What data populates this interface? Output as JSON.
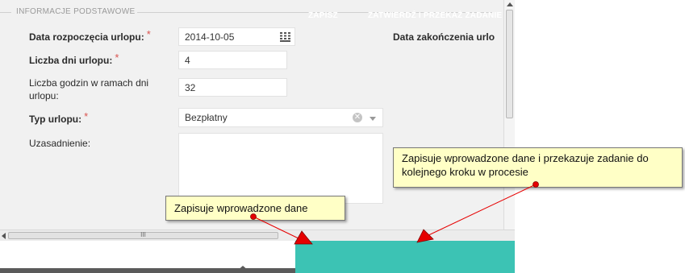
{
  "section": {
    "title": "INFORMACJE PODSTAWOWE"
  },
  "form": {
    "start_date_label": "Data rozpoczęcia urlopu:",
    "start_date_value": "2014-10-05",
    "end_date_label": "Data zakończenia urlo",
    "days_label": "Liczba dni urlopu:",
    "days_value": "4",
    "hours_label": "Liczba godzin w ramach dni urlopu:",
    "hours_value": "32",
    "type_label": "Typ urlopu:",
    "type_value": "Bezpłatny",
    "justification_label": "Uzasadnienie:",
    "justification_value": "",
    "required_mark": "*"
  },
  "buttons": {
    "save": "ZAPISZ",
    "approve": "ZATWIERDŹ I PRZEKAŻ ZADANIE"
  },
  "callouts": {
    "approve_note": "Zapisuje wprowadzone dane i przekazuje zadanie do kolejnego kroku w procesie",
    "save_note": "Zapisuje wprowadzone dane"
  },
  "scrollbar": {
    "grip": "III"
  },
  "colors": {
    "button_bar": "#3cc3b4",
    "callout_bg": "#ffffc6",
    "arrow_red": "#e60000",
    "required": "#d9534f"
  },
  "icons": {
    "calendar": "calendar-icon",
    "clear": "clear-icon",
    "dropdown": "chevron-down-icon"
  }
}
